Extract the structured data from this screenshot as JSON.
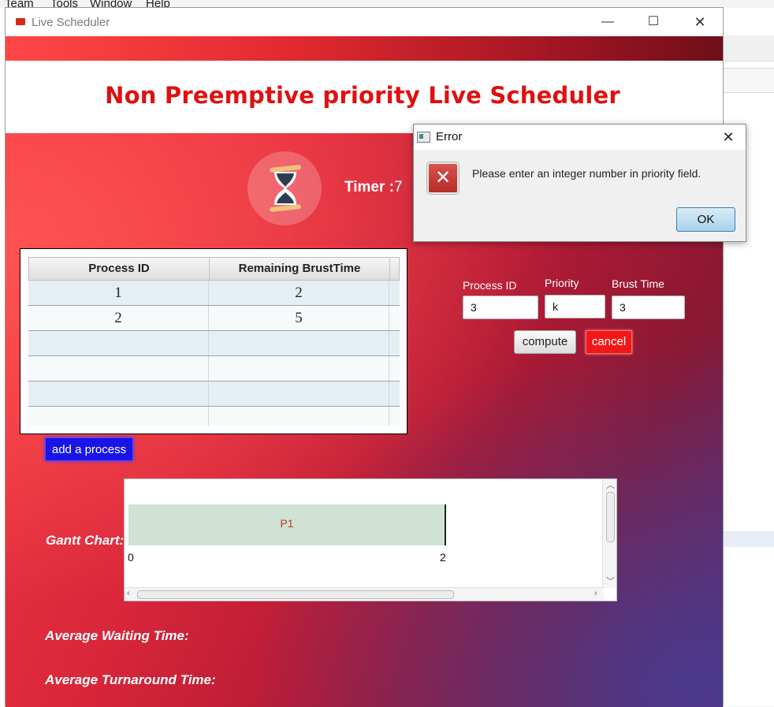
{
  "background_app": {
    "menu": [
      "Team",
      "Tools",
      "Window",
      "Help"
    ]
  },
  "window": {
    "title": "Live Scheduler",
    "controls": {
      "minimize": "—",
      "maximize": "☐",
      "close": "✕"
    }
  },
  "header": {
    "title": "Non Preemptive priority Live Scheduler",
    "accent_color": "#e01010"
  },
  "timer": {
    "label": "Timer :",
    "value": "7"
  },
  "process_table": {
    "columns": [
      "Process ID",
      "Remaining BrustTime"
    ],
    "rows": [
      [
        "1",
        "2"
      ],
      [
        "2",
        "5"
      ],
      [
        "",
        ""
      ],
      [
        "",
        ""
      ],
      [
        "",
        ""
      ],
      [
        "",
        ""
      ]
    ]
  },
  "add_process_button": "add a process",
  "form": {
    "process_id_label": "Process ID",
    "priority_label": "Priority",
    "brust_time_label": "Brust Time",
    "process_id_value": "3",
    "priority_value": "k",
    "brust_time_value": "3",
    "compute_label": "compute",
    "cancel_label": "cancel"
  },
  "gantt": {
    "label": "Gantt Chart:",
    "bars": [
      {
        "name": "P1",
        "start": 0,
        "end": 2
      }
    ],
    "ticks": [
      "0",
      "2"
    ]
  },
  "stats": {
    "avg_waiting_label": "Average Waiting Time:",
    "avg_turnaround_label": "Average Turnaround Time:"
  },
  "error_dialog": {
    "title": "Error",
    "message": "Please enter an integer number in priority field.",
    "ok_label": "OK",
    "close_glyph": "✕",
    "icon_glyph": "✕"
  }
}
